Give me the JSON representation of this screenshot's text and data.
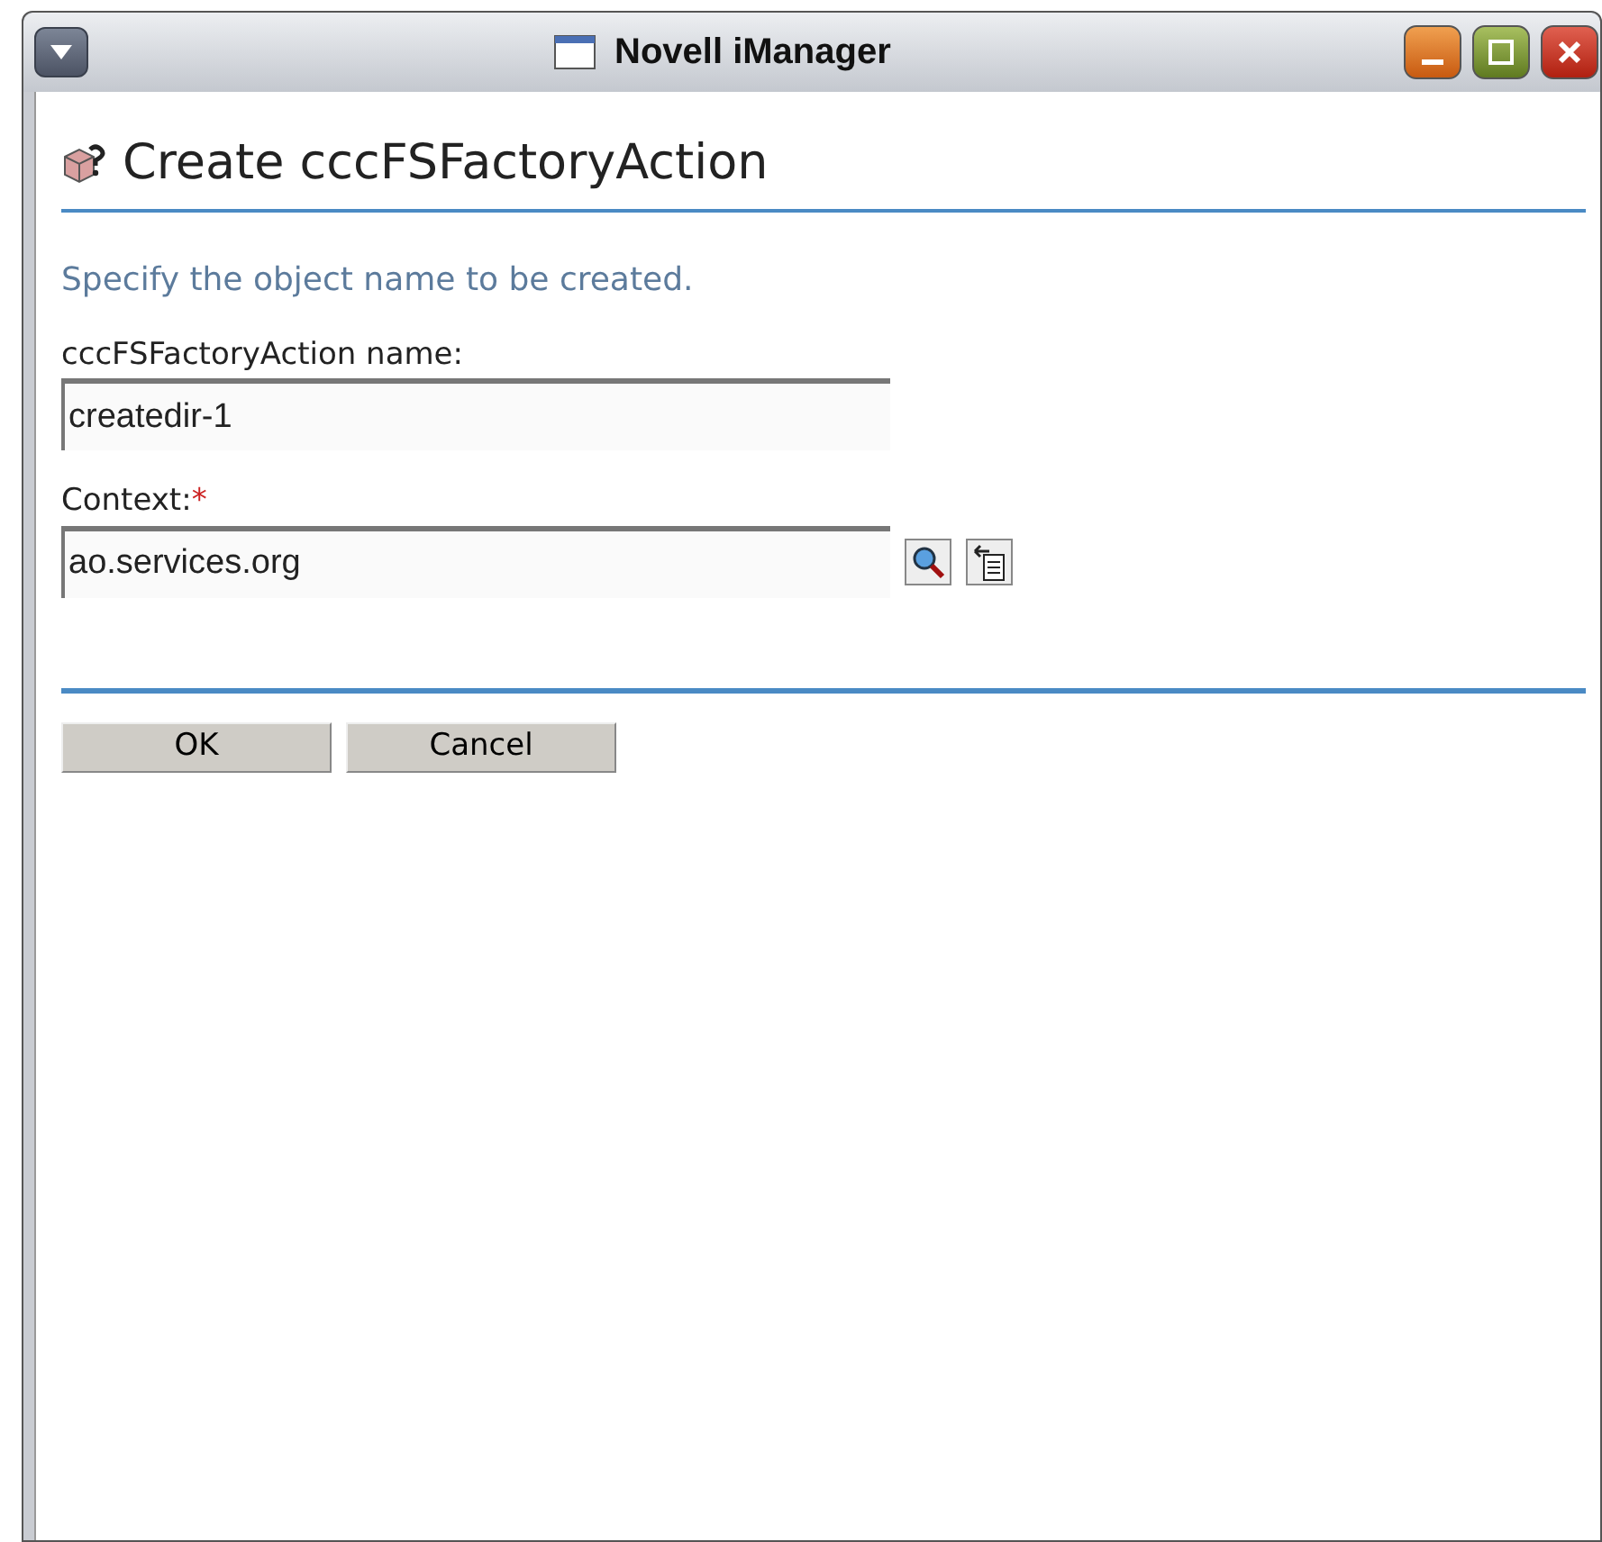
{
  "window": {
    "title": "Novell iManager"
  },
  "heading": "Create cccFSFactoryAction",
  "instruction": "Specify the object name to be created.",
  "fields": [
    {
      "kind": "plain",
      "label": "cccFSFactoryAction name:",
      "value": "createdir-1"
    },
    {
      "kind": "browse",
      "label": "Context:",
      "required_mark": "*",
      "value": "ao.services.org"
    }
  ],
  "buttons": [
    "OK",
    "Cancel"
  ]
}
